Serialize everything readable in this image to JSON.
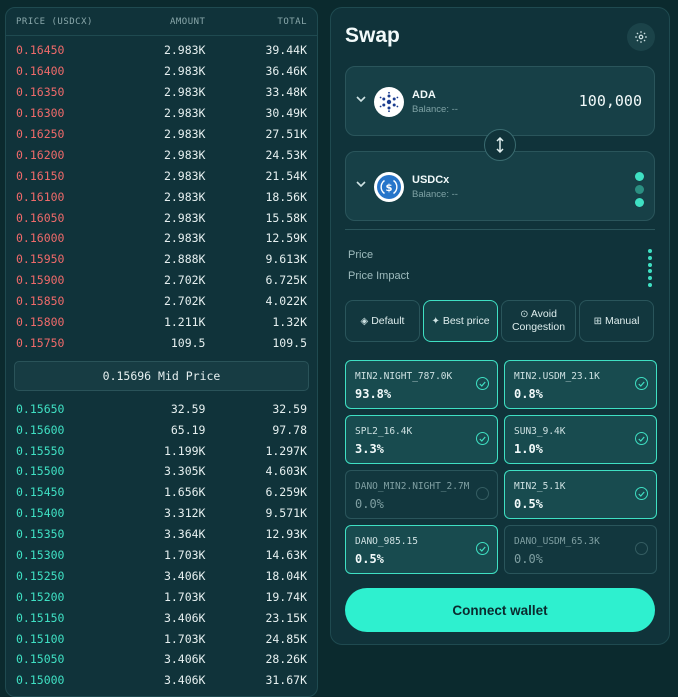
{
  "orderbook": {
    "headers": {
      "price": "PRICE (USDCX)",
      "amount": "AMOUNT",
      "total": "TOTAL"
    },
    "asks": [
      {
        "price": "0.16450",
        "amount": "2.983K",
        "total": "39.44K"
      },
      {
        "price": "0.16400",
        "amount": "2.983K",
        "total": "36.46K"
      },
      {
        "price": "0.16350",
        "amount": "2.983K",
        "total": "33.48K"
      },
      {
        "price": "0.16300",
        "amount": "2.983K",
        "total": "30.49K"
      },
      {
        "price": "0.16250",
        "amount": "2.983K",
        "total": "27.51K"
      },
      {
        "price": "0.16200",
        "amount": "2.983K",
        "total": "24.53K"
      },
      {
        "price": "0.16150",
        "amount": "2.983K",
        "total": "21.54K"
      },
      {
        "price": "0.16100",
        "amount": "2.983K",
        "total": "18.56K"
      },
      {
        "price": "0.16050",
        "amount": "2.983K",
        "total": "15.58K"
      },
      {
        "price": "0.16000",
        "amount": "2.983K",
        "total": "12.59K"
      },
      {
        "price": "0.15950",
        "amount": "2.888K",
        "total": "9.613K"
      },
      {
        "price": "0.15900",
        "amount": "2.702K",
        "total": "6.725K"
      },
      {
        "price": "0.15850",
        "amount": "2.702K",
        "total": "4.022K"
      },
      {
        "price": "0.15800",
        "amount": "1.211K",
        "total": "1.32K"
      },
      {
        "price": "0.15750",
        "amount": "109.5",
        "total": "109.5"
      }
    ],
    "mid_price": "0.15696 Mid Price",
    "bids": [
      {
        "price": "0.15650",
        "amount": "32.59",
        "total": "32.59"
      },
      {
        "price": "0.15600",
        "amount": "65.19",
        "total": "97.78"
      },
      {
        "price": "0.15550",
        "amount": "1.199K",
        "total": "1.297K"
      },
      {
        "price": "0.15500",
        "amount": "3.305K",
        "total": "4.603K"
      },
      {
        "price": "0.15450",
        "amount": "1.656K",
        "total": "6.259K"
      },
      {
        "price": "0.15400",
        "amount": "3.312K",
        "total": "9.571K"
      },
      {
        "price": "0.15350",
        "amount": "3.364K",
        "total": "12.93K"
      },
      {
        "price": "0.15300",
        "amount": "1.703K",
        "total": "14.63K"
      },
      {
        "price": "0.15250",
        "amount": "3.406K",
        "total": "18.04K"
      },
      {
        "price": "0.15200",
        "amount": "1.703K",
        "total": "19.74K"
      },
      {
        "price": "0.15150",
        "amount": "3.406K",
        "total": "23.15K"
      },
      {
        "price": "0.15100",
        "amount": "1.703K",
        "total": "24.85K"
      },
      {
        "price": "0.15050",
        "amount": "3.406K",
        "total": "28.26K"
      },
      {
        "price": "0.15000",
        "amount": "3.406K",
        "total": "31.67K"
      }
    ],
    "colors": {
      "ask": "#ef6a6a",
      "bid": "#3fe0c3"
    }
  },
  "swap": {
    "title": "Swap",
    "from": {
      "token": "ADA",
      "balance": "Balance: --",
      "amount": "100,000",
      "icon": "cardano-icon"
    },
    "to": {
      "token": "USDCx",
      "balance": "Balance: --",
      "icon": "usdc-icon"
    },
    "price_label": "Price",
    "impact_label": "Price Impact",
    "modes": [
      {
        "label": "Default",
        "icon": "diamond-icon",
        "active": false
      },
      {
        "label": "Best price",
        "icon": "sparkle-icon",
        "active": true
      },
      {
        "label": "Avoid Congestion",
        "icon": "circle-icon",
        "active": false
      },
      {
        "label": "Manual",
        "icon": "grid-icon",
        "active": false
      }
    ],
    "routes": [
      {
        "name": "MIN2.NIGHT_787.0K",
        "pct": "93.8%",
        "selected": true
      },
      {
        "name": "MIN2.USDM_23.1K",
        "pct": "0.8%",
        "selected": true
      },
      {
        "name": "SPL2_16.4K",
        "pct": "3.3%",
        "selected": true
      },
      {
        "name": "SUN3_9.4K",
        "pct": "1.0%",
        "selected": true
      },
      {
        "name": "DANO_MIN2.NIGHT_2.7M",
        "pct": "0.0%",
        "selected": false
      },
      {
        "name": "MIN2_5.1K",
        "pct": "0.5%",
        "selected": true
      },
      {
        "name": "DANO_985.15",
        "pct": "0.5%",
        "selected": true
      },
      {
        "name": "DANO_USDM_65.3K",
        "pct": "0.0%",
        "selected": false
      }
    ],
    "connect_label": "Connect wallet",
    "accent": "#2ef0cf"
  }
}
